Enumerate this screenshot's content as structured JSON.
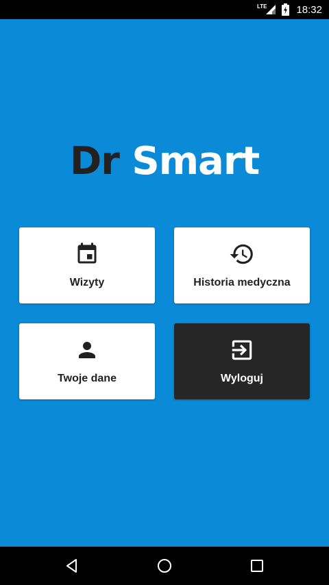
{
  "status_bar": {
    "network_label": "LTE",
    "time": "18:32"
  },
  "logo": {
    "part1": "Dr",
    "part2": "Smart"
  },
  "menu": {
    "tiles": [
      {
        "label": "Wizyty",
        "icon": "calendar-icon"
      },
      {
        "label": "Historia medyczna",
        "icon": "history-icon"
      },
      {
        "label": "Twoje dane",
        "icon": "person-icon"
      },
      {
        "label": "Wyloguj",
        "icon": "logout-icon"
      }
    ]
  },
  "colors": {
    "background": "#0b8ad8",
    "logo_dark": "#212121",
    "logo_light": "#ffffff",
    "tile_light": "#ffffff",
    "tile_dark": "#262626"
  },
  "nav_bar": {
    "buttons": [
      "back-icon",
      "home-icon",
      "recents-icon"
    ]
  }
}
